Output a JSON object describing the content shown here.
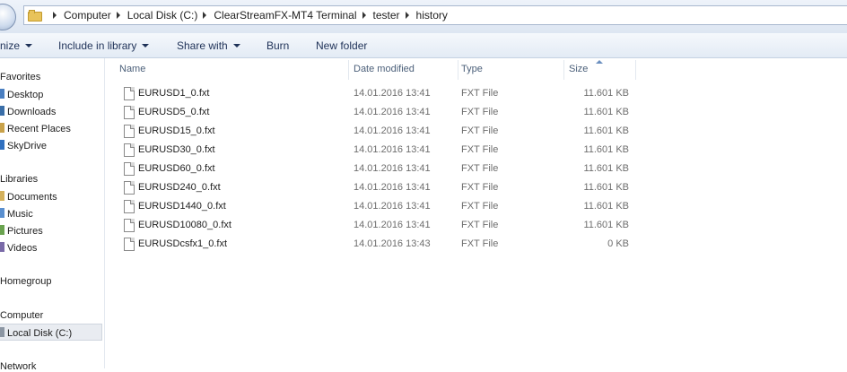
{
  "address_bar": {
    "breadcrumbs": [
      "Computer",
      "Local Disk (C:)",
      "ClearStreamFX-MT4 Terminal",
      "tester",
      "history"
    ]
  },
  "toolbar": {
    "organize_label": "nize",
    "include_label": "Include in library",
    "share_label": "Share with",
    "burn_label": "Burn",
    "new_folder_label": "New folder"
  },
  "nav": {
    "favorites": "Favorites",
    "favorites_items": [
      "Desktop",
      "Downloads",
      "Recent Places",
      "SkyDrive"
    ],
    "libraries": "Libraries",
    "libraries_items": [
      "Documents",
      "Music",
      "Pictures",
      "Videos"
    ],
    "homegroup": "Homegroup",
    "computer": "Computer",
    "computer_items": [
      "Local Disk (C:)"
    ],
    "network": "Network"
  },
  "columns": {
    "name": "Name",
    "date": "Date modified",
    "type": "Type",
    "size": "Size"
  },
  "files": [
    {
      "name": "EURUSD1_0.fxt",
      "date": "14.01.2016 13:41",
      "type": "FXT File",
      "size": "11.601 KB"
    },
    {
      "name": "EURUSD5_0.fxt",
      "date": "14.01.2016 13:41",
      "type": "FXT File",
      "size": "11.601 KB"
    },
    {
      "name": "EURUSD15_0.fxt",
      "date": "14.01.2016 13:41",
      "type": "FXT File",
      "size": "11.601 KB"
    },
    {
      "name": "EURUSD30_0.fxt",
      "date": "14.01.2016 13:41",
      "type": "FXT File",
      "size": "11.601 KB"
    },
    {
      "name": "EURUSD60_0.fxt",
      "date": "14.01.2016 13:41",
      "type": "FXT File",
      "size": "11.601 KB"
    },
    {
      "name": "EURUSD240_0.fxt",
      "date": "14.01.2016 13:41",
      "type": "FXT File",
      "size": "11.601 KB"
    },
    {
      "name": "EURUSD1440_0.fxt",
      "date": "14.01.2016 13:41",
      "type": "FXT File",
      "size": "11.601 KB"
    },
    {
      "name": "EURUSD10080_0.fxt",
      "date": "14.01.2016 13:41",
      "type": "FXT File",
      "size": "11.601 KB"
    },
    {
      "name": "EURUSDcsfx1_0.fxt",
      "date": "14.01.2016 13:43",
      "type": "FXT File",
      "size": "0 KB"
    }
  ]
}
